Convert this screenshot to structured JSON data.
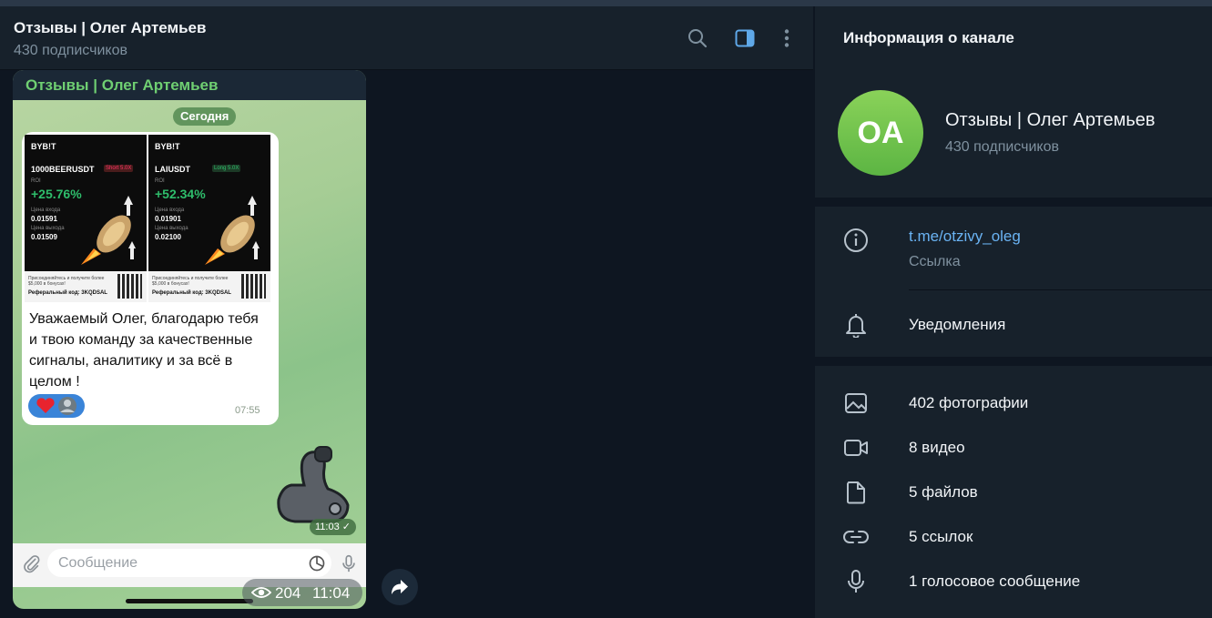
{
  "header": {
    "title": "Отзывы | Олег Артемьев",
    "subtitle": "430 подписчиков"
  },
  "phone": {
    "channel_title": "Отзывы | Олег Артемьев",
    "date_label": "Сегодня",
    "cards": [
      {
        "brand": "BYB!T",
        "pair": "1000BEERUSDT",
        "side": "Short 5.0X",
        "roi_label": "ROI",
        "roi": "+25.76%",
        "entry_label": "Цена входа",
        "entry": "0.01591",
        "exit_label": "Цена выхода",
        "exit": "0.01509",
        "promo": "Присоединяйтесь и получите более $5,000 в бонусах!",
        "ref": "Реферальный код: 3KQDSAL"
      },
      {
        "brand": "BYB!T",
        "pair": "LAIUSDT",
        "side": "Long 5.0X",
        "roi_label": "ROI",
        "roi": "+52.34%",
        "entry_label": "Цена входа",
        "entry": "0.01901",
        "exit_label": "Цена выхода",
        "exit": "0.02100",
        "promo": "Присоединяйтесь и получите более $5,000 в бонусах!",
        "ref": "Реферальный код: 3KQDSAL"
      }
    ],
    "message_text": "Уважаемый Олег, благодарю тебя и твою команду за качественные сигналы, аналитику и за всё в целом !",
    "message_time": "07:55",
    "sticker_time": "11:03",
    "input_placeholder": "Сообщение"
  },
  "post": {
    "views": "204",
    "time": "11:04"
  },
  "info_panel": {
    "title": "Информация о канале",
    "avatar_initials": "OA",
    "avatar_color": "#6ec24e",
    "name": "Отзывы | Олег Артемьев",
    "subscribers": "430 подписчиков",
    "link": "t.me/otzivy_oleg",
    "link_caption": "Ссылка",
    "notifications": "Уведомления",
    "media": [
      {
        "icon": "photo-icon",
        "label": "402 фотографии"
      },
      {
        "icon": "video-icon",
        "label": "8 видео"
      },
      {
        "icon": "file-icon",
        "label": "5 файлов"
      },
      {
        "icon": "link-icon",
        "label": "5 ссылок"
      },
      {
        "icon": "microphone-icon",
        "label": "1 голосовое сообщение"
      }
    ]
  },
  "colors": {
    "accent": "#6ab3f3",
    "panel_bg": "#17212b",
    "app_bg": "#0e1621",
    "roi_green": "#2ebd6b"
  }
}
